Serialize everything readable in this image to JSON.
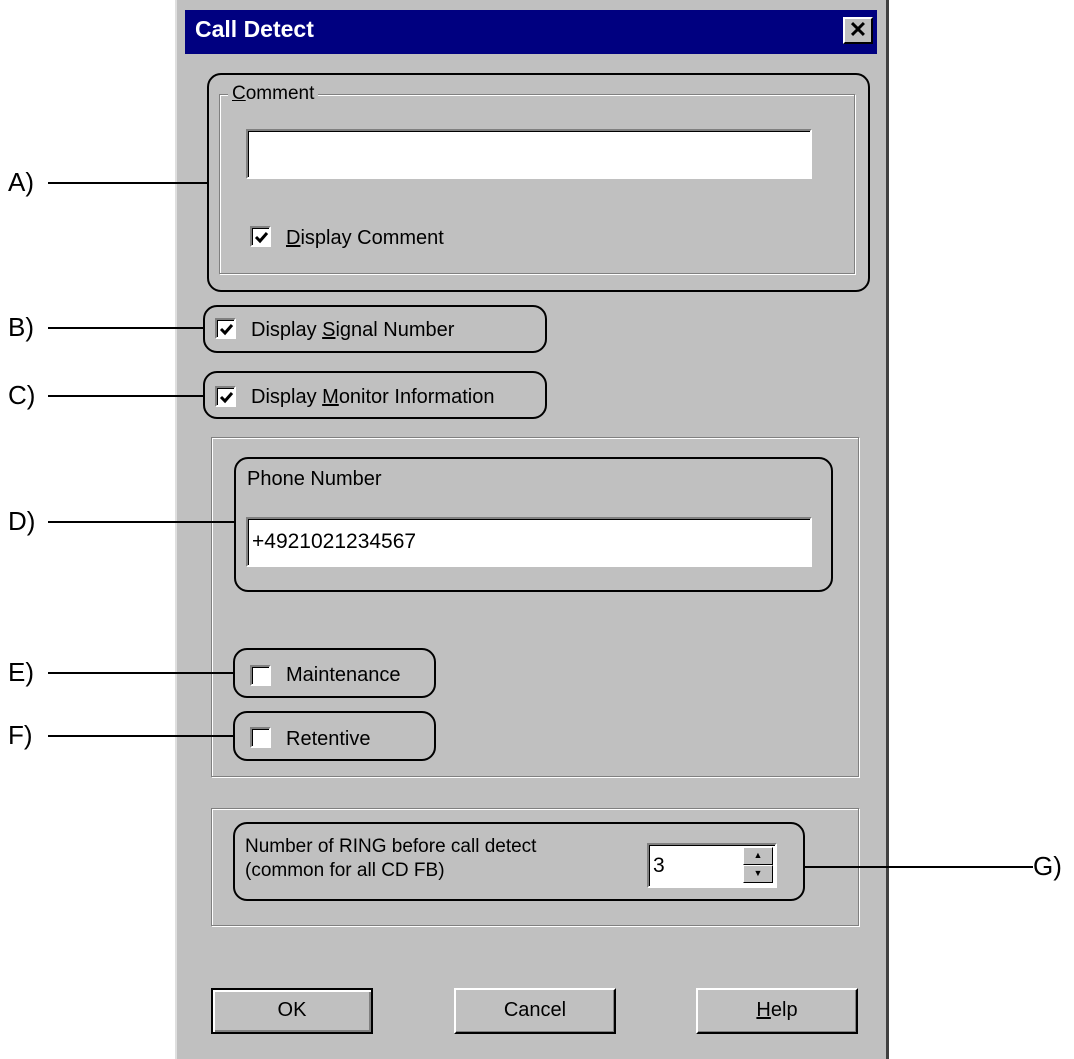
{
  "dialog": {
    "title": "Call Detect",
    "close_symbol": "✕"
  },
  "comment_group": {
    "label_accel": "C",
    "label_rest": "omment",
    "value": "",
    "display_comment": {
      "accel": "D",
      "rest": "isplay Comment",
      "checked": true
    }
  },
  "display_signal_number": {
    "pre": "Display ",
    "accel": "S",
    "rest": "ignal Number",
    "checked": true
  },
  "display_monitor_information": {
    "pre": "Display ",
    "accel": "M",
    "rest": "onitor Information",
    "checked": true
  },
  "phone_group": {
    "label": "Phone Number",
    "value": "+4921021234567"
  },
  "maintenance": {
    "label": "Maintenance",
    "checked": false
  },
  "retentive": {
    "label": "Retentive",
    "checked": false
  },
  "ring_group": {
    "line1": "Number of RING before call detect",
    "line2": "(common for all CD FB)",
    "value": "3"
  },
  "buttons": {
    "ok": "OK",
    "cancel": "Cancel",
    "help_accel": "H",
    "help_rest": "elp"
  },
  "callouts": {
    "a": "A)",
    "b": "B)",
    "c": "C)",
    "d": "D)",
    "e": "E)",
    "f": "F)",
    "g": "G)"
  }
}
